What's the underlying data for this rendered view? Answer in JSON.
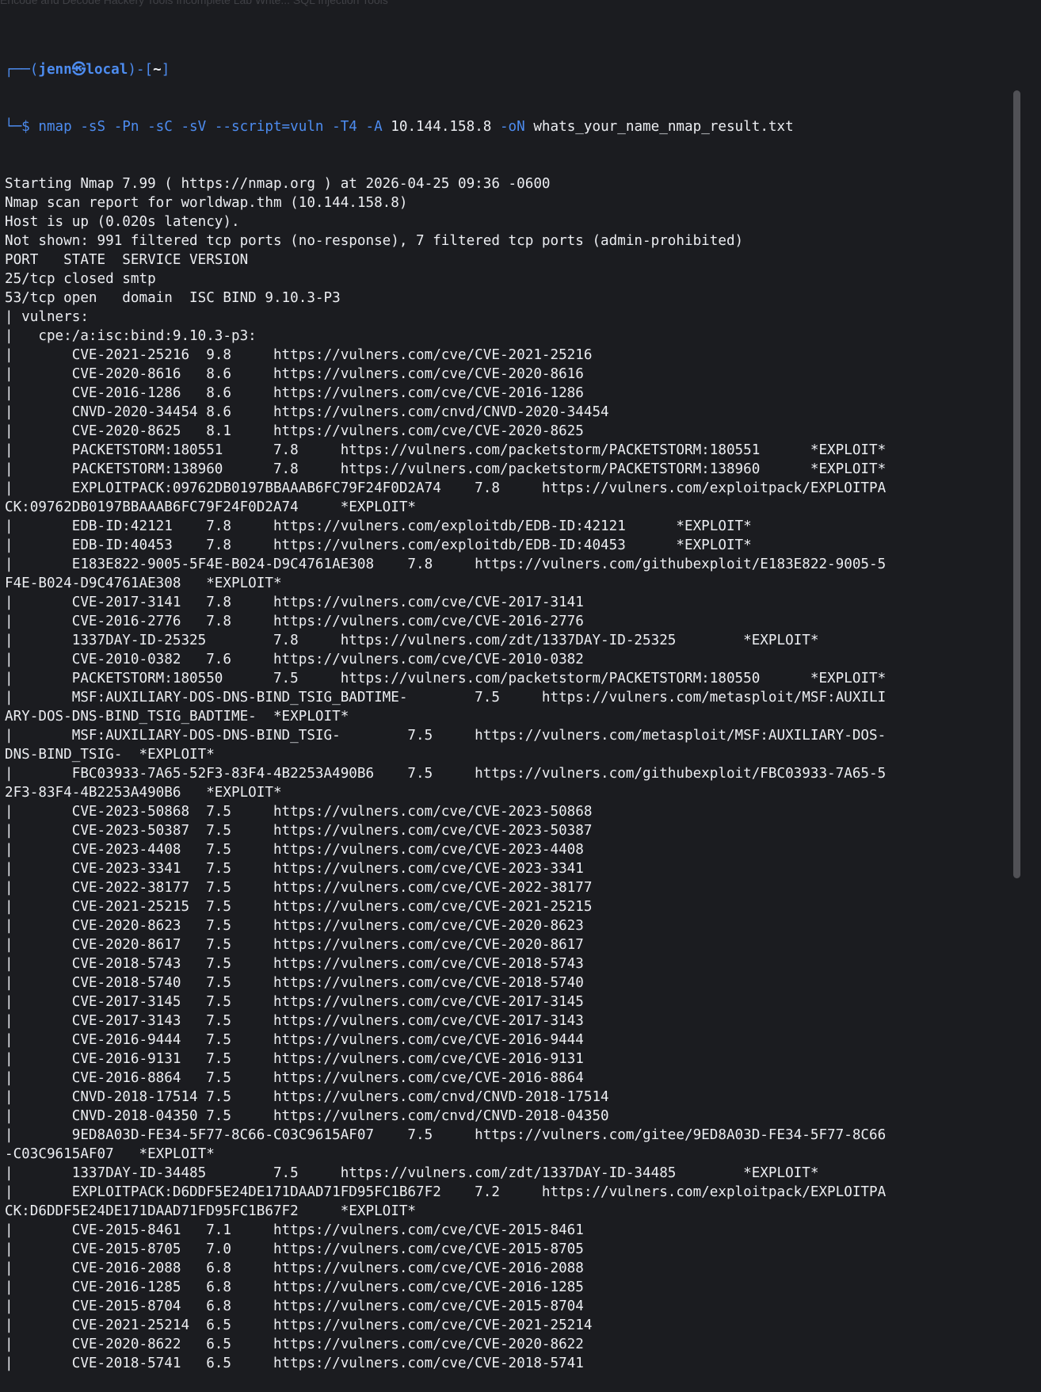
{
  "background_tab_text": "Encode and Decode   Hackery Tools   Incomplete Lab Write...   SQL Injection Tools",
  "prompt": {
    "open": "┌──(",
    "user": "jenn",
    "at_icon": "㉿",
    "host": "local",
    "mid": ")-[",
    "dir": "~",
    "close": "]",
    "arrow": "└─$ ",
    "command": "nmap",
    "args": " -sS -Pn -sC -sV --script=vuln -T4 -A",
    "target": " 10.144.158.8",
    "out_flag": " -oN",
    "out_file": " whats_your_name_nmap_result.txt"
  },
  "output_lines": [
    "Starting Nmap 7.99 ( https://nmap.org ) at 2026-04-25 09:36 -0600",
    "Nmap scan report for worldwap.thm (10.144.158.8)",
    "Host is up (0.020s latency).",
    "Not shown: 991 filtered tcp ports (no-response), 7 filtered tcp ports (admin-prohibited)",
    "PORT   STATE  SERVICE VERSION",
    "25/tcp closed smtp",
    "53/tcp open   domain  ISC BIND 9.10.3-P3",
    "| vulners:",
    "|   cpe:/a:isc:bind:9.10.3-p3:",
    "|       CVE-2021-25216  9.8     https://vulners.com/cve/CVE-2021-25216",
    "|       CVE-2020-8616   8.6     https://vulners.com/cve/CVE-2020-8616",
    "|       CVE-2016-1286   8.6     https://vulners.com/cve/CVE-2016-1286",
    "|       CNVD-2020-34454 8.6     https://vulners.com/cnvd/CNVD-2020-34454",
    "|       CVE-2020-8625   8.1     https://vulners.com/cve/CVE-2020-8625",
    "|       PACKETSTORM:180551      7.8     https://vulners.com/packetstorm/PACKETSTORM:180551      *EXPLOIT*",
    "|       PACKETSTORM:138960      7.8     https://vulners.com/packetstorm/PACKETSTORM:138960      *EXPLOIT*",
    "|       EXPLOITPACK:09762DB0197BBAAAB6FC79F24F0D2A74    7.8     https://vulners.com/exploitpack/EXPLOITPA",
    "CK:09762DB0197BBAAAB6FC79F24F0D2A74     *EXPLOIT*",
    "|       EDB-ID:42121    7.8     https://vulners.com/exploitdb/EDB-ID:42121      *EXPLOIT*",
    "|       EDB-ID:40453    7.8     https://vulners.com/exploitdb/EDB-ID:40453      *EXPLOIT*",
    "|       E183E822-9005-5F4E-B024-D9C4761AE308    7.8     https://vulners.com/githubexploit/E183E822-9005-5",
    "F4E-B024-D9C4761AE308   *EXPLOIT*",
    "|       CVE-2017-3141   7.8     https://vulners.com/cve/CVE-2017-3141",
    "|       CVE-2016-2776   7.8     https://vulners.com/cve/CVE-2016-2776",
    "|       1337DAY-ID-25325        7.8     https://vulners.com/zdt/1337DAY-ID-25325        *EXPLOIT*",
    "|       CVE-2010-0382   7.6     https://vulners.com/cve/CVE-2010-0382",
    "|       PACKETSTORM:180550      7.5     https://vulners.com/packetstorm/PACKETSTORM:180550      *EXPLOIT*",
    "|       MSF:AUXILIARY-DOS-DNS-BIND_TSIG_BADTIME-        7.5     https://vulners.com/metasploit/MSF:AUXILI",
    "ARY-DOS-DNS-BIND_TSIG_BADTIME-  *EXPLOIT*",
    "|       MSF:AUXILIARY-DOS-DNS-BIND_TSIG-        7.5     https://vulners.com/metasploit/MSF:AUXILIARY-DOS-",
    "DNS-BIND_TSIG-  *EXPLOIT*",
    "|       FBC03933-7A65-52F3-83F4-4B2253A490B6    7.5     https://vulners.com/githubexploit/FBC03933-7A65-5",
    "2F3-83F4-4B2253A490B6   *EXPLOIT*",
    "|       CVE-2023-50868  7.5     https://vulners.com/cve/CVE-2023-50868",
    "|       CVE-2023-50387  7.5     https://vulners.com/cve/CVE-2023-50387",
    "|       CVE-2023-4408   7.5     https://vulners.com/cve/CVE-2023-4408",
    "|       CVE-2023-3341   7.5     https://vulners.com/cve/CVE-2023-3341",
    "|       CVE-2022-38177  7.5     https://vulners.com/cve/CVE-2022-38177",
    "|       CVE-2021-25215  7.5     https://vulners.com/cve/CVE-2021-25215",
    "|       CVE-2020-8623   7.5     https://vulners.com/cve/CVE-2020-8623",
    "|       CVE-2020-8617   7.5     https://vulners.com/cve/CVE-2020-8617",
    "|       CVE-2018-5743   7.5     https://vulners.com/cve/CVE-2018-5743",
    "|       CVE-2018-5740   7.5     https://vulners.com/cve/CVE-2018-5740",
    "|       CVE-2017-3145   7.5     https://vulners.com/cve/CVE-2017-3145",
    "|       CVE-2017-3143   7.5     https://vulners.com/cve/CVE-2017-3143",
    "|       CVE-2016-9444   7.5     https://vulners.com/cve/CVE-2016-9444",
    "|       CVE-2016-9131   7.5     https://vulners.com/cve/CVE-2016-9131",
    "|       CVE-2016-8864   7.5     https://vulners.com/cve/CVE-2016-8864",
    "|       CNVD-2018-17514 7.5     https://vulners.com/cnvd/CNVD-2018-17514",
    "|       CNVD-2018-04350 7.5     https://vulners.com/cnvd/CNVD-2018-04350",
    "|       9ED8A03D-FE34-5F77-8C66-C03C9615AF07    7.5     https://vulners.com/gitee/9ED8A03D-FE34-5F77-8C66",
    "-C03C9615AF07   *EXPLOIT*",
    "|       1337DAY-ID-34485        7.5     https://vulners.com/zdt/1337DAY-ID-34485        *EXPLOIT*",
    "|       EXPLOITPACK:D6DDF5E24DE171DAAD71FD95FC1B67F2    7.2     https://vulners.com/exploitpack/EXPLOITPA",
    "CK:D6DDF5E24DE171DAAD71FD95FC1B67F2     *EXPLOIT*",
    "|       CVE-2015-8461   7.1     https://vulners.com/cve/CVE-2015-8461",
    "|       CVE-2015-8705   7.0     https://vulners.com/cve/CVE-2015-8705",
    "|       CVE-2016-2088   6.8     https://vulners.com/cve/CVE-2016-2088",
    "|       CVE-2016-1285   6.8     https://vulners.com/cve/CVE-2016-1285",
    "|       CVE-2015-8704   6.8     https://vulners.com/cve/CVE-2015-8704",
    "|       CVE-2021-25214  6.5     https://vulners.com/cve/CVE-2021-25214",
    "|       CVE-2020-8622   6.5     https://vulners.com/cve/CVE-2020-8622",
    "|       CVE-2018-5741   6.5     https://vulners.com/cve/CVE-2018-5741"
  ]
}
